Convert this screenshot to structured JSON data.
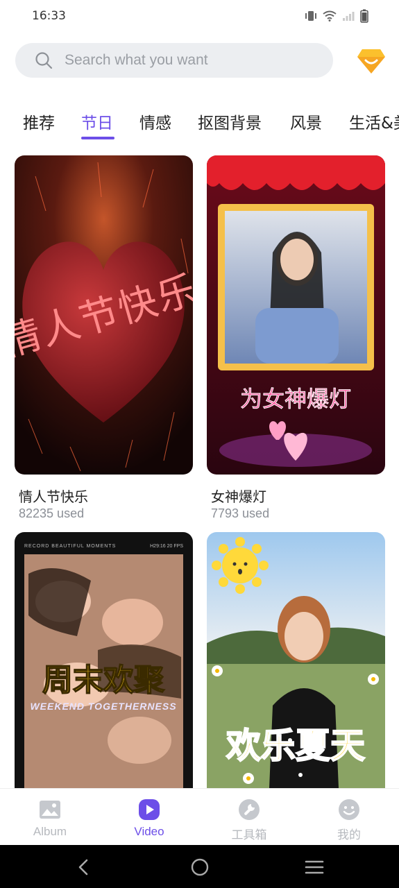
{
  "status_bar": {
    "time": "16:33"
  },
  "search": {
    "placeholder": "Search what you want"
  },
  "tabs": [
    {
      "label": "推荐"
    },
    {
      "label": "节日",
      "active": true
    },
    {
      "label": "情感"
    },
    {
      "label": "抠图背景"
    },
    {
      "label": "风景"
    },
    {
      "label": "生活&美"
    }
  ],
  "cards": [
    {
      "title": "情人节快乐",
      "used": "82235 used",
      "overlay_text": "情人节快乐"
    },
    {
      "title": "女神爆灯",
      "used": "7793 used",
      "overlay_text": "为女神爆灯"
    },
    {
      "overlay_text": "周末欢聚",
      "overlay_sub": "WEEKEND TOGETHERNESS",
      "overlay_top_left": "RECORD BEAUTIFUL MOMENTS",
      "overlay_top_right": "H29:16 20 FPS"
    },
    {
      "overlay_text": "欢乐夏天"
    }
  ],
  "bottom_nav": {
    "items": [
      {
        "label": "Album"
      },
      {
        "label": "Video",
        "active": true
      },
      {
        "label": "工具箱"
      },
      {
        "label": "我的"
      }
    ]
  },
  "colors": {
    "accent": "#6c4ee8",
    "search_bg": "#eceef1",
    "muted": "#b6b9be"
  }
}
